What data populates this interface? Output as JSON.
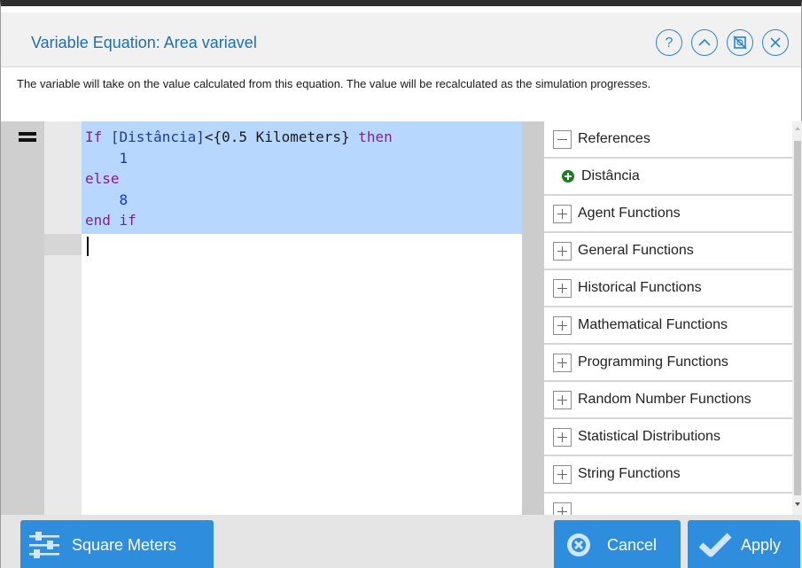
{
  "dialog": {
    "title": "Variable Equation: Area variavel",
    "icons": [
      "help-icon",
      "collapse-up-icon",
      "no-image-icon",
      "close-icon"
    ],
    "description": "The variable will take on the value calculated from this equation. The value will be recalculated as the simulation progresses."
  },
  "editor": {
    "lines": [
      {
        "kw1": "If ",
        "ref": "[Distância]",
        "op": "<",
        "unit": "{0.5 Kilometers}",
        "kw2": " then"
      },
      {
        "num": "1"
      },
      {
        "kw": "else"
      },
      {
        "num": "8"
      },
      {
        "kw": "end if"
      }
    ]
  },
  "panel": {
    "items": [
      {
        "label": "References",
        "type": "collapse"
      },
      {
        "label": "Distância",
        "type": "reference"
      },
      {
        "label": "Agent Functions",
        "type": "expand"
      },
      {
        "label": "General Functions",
        "type": "expand"
      },
      {
        "label": "Historical Functions",
        "type": "expand"
      },
      {
        "label": "Mathematical Functions",
        "type": "expand"
      },
      {
        "label": "Programming Functions",
        "type": "expand"
      },
      {
        "label": "Random Number Functions",
        "type": "expand"
      },
      {
        "label": "Statistical Distributions",
        "type": "expand"
      },
      {
        "label": "String Functions",
        "type": "expand"
      }
    ]
  },
  "footer": {
    "units_label": "Square Meters",
    "cancel_label": "Cancel",
    "apply_label": "Apply"
  },
  "colors": {
    "accent": "#2e8ddc",
    "title": "#1d6fb4",
    "selection": "#b8d7fe",
    "keyword": "#8a1d8c",
    "number": "#1733c4",
    "reference_icon": "#1a7f1a"
  }
}
